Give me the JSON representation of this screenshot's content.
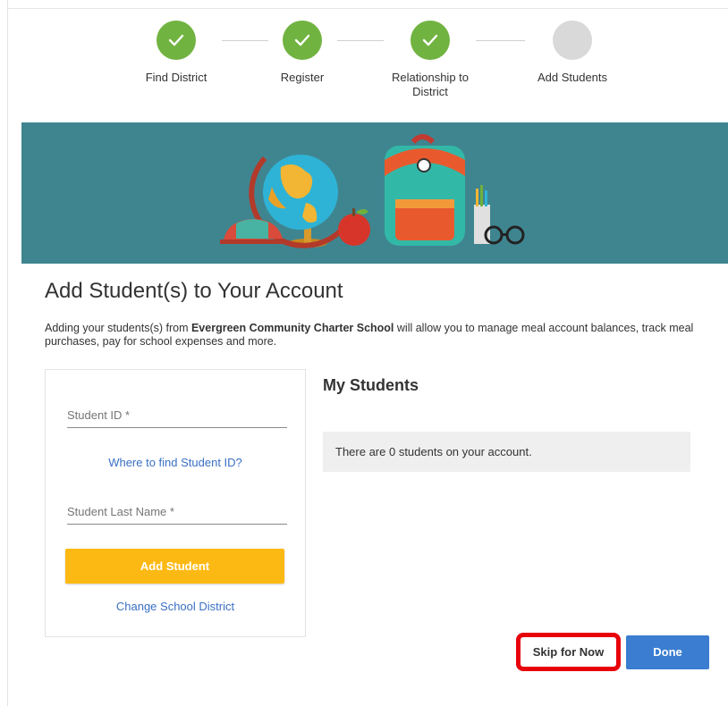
{
  "stepper": {
    "steps": [
      {
        "label": "Find District",
        "status": "complete"
      },
      {
        "label": "Register",
        "status": "complete"
      },
      {
        "label": "Relationship to District",
        "status": "complete"
      },
      {
        "label": "Add Students",
        "status": "current"
      }
    ]
  },
  "page": {
    "title": "Add Student(s) to Your Account",
    "intro_prefix": "Adding your students(s) from ",
    "school_name": "Evergreen Community Charter School",
    "intro_suffix": " will allow you to manage meal account balances, track meal purchases, pay for school expenses and more."
  },
  "form": {
    "student_id_placeholder": "Student ID *",
    "where_to_find_link": "Where to find Student ID?",
    "last_name_placeholder": "Student Last Name *",
    "add_button": "Add Student",
    "change_district_link": "Change School District"
  },
  "my_students": {
    "title": "My Students",
    "empty_message": "There are 0 students on your account."
  },
  "actions": {
    "skip_label": "Skip for Now",
    "done_label": "Done"
  },
  "colors": {
    "complete": "#71b341",
    "pending": "#d9d9d9",
    "banner": "#3f8590",
    "accent_yellow": "#fdb913",
    "primary_blue": "#3a7dd1",
    "highlight_red": "#e8000b"
  }
}
